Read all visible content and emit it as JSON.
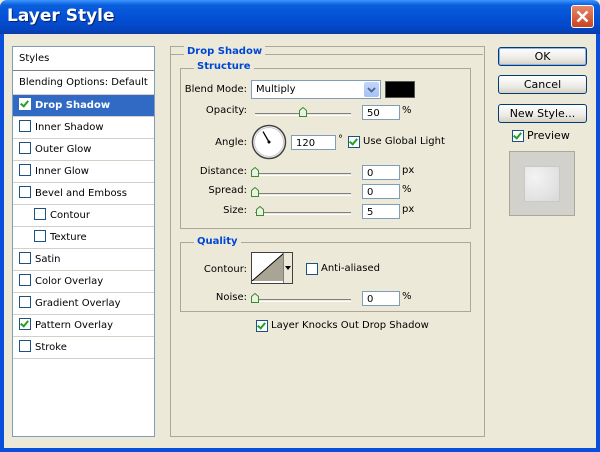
{
  "window": {
    "title": "Layer Style"
  },
  "styles_list": {
    "header": "Styles",
    "blending": "Blending Options: Default",
    "items": [
      {
        "label": "Drop Shadow",
        "checked": true,
        "selected": true,
        "indent": false
      },
      {
        "label": "Inner Shadow",
        "checked": false,
        "selected": false,
        "indent": false
      },
      {
        "label": "Outer Glow",
        "checked": false,
        "selected": false,
        "indent": false
      },
      {
        "label": "Inner Glow",
        "checked": false,
        "selected": false,
        "indent": false
      },
      {
        "label": "Bevel and Emboss",
        "checked": false,
        "selected": false,
        "indent": false
      },
      {
        "label": "Contour",
        "checked": false,
        "selected": false,
        "indent": true
      },
      {
        "label": "Texture",
        "checked": false,
        "selected": false,
        "indent": true
      },
      {
        "label": "Satin",
        "checked": false,
        "selected": false,
        "indent": false
      },
      {
        "label": "Color Overlay",
        "checked": false,
        "selected": false,
        "indent": false
      },
      {
        "label": "Gradient Overlay",
        "checked": false,
        "selected": false,
        "indent": false
      },
      {
        "label": "Pattern Overlay",
        "checked": true,
        "selected": false,
        "indent": false
      },
      {
        "label": "Stroke",
        "checked": false,
        "selected": false,
        "indent": false
      }
    ]
  },
  "drop_shadow": {
    "title": "Drop Shadow",
    "structure": {
      "title": "Structure",
      "blend_mode_label": "Blend Mode:",
      "blend_mode_value": "Multiply",
      "shadow_color": "#000000",
      "opacity_label": "Opacity:",
      "opacity_value": "50",
      "opacity_unit": "%",
      "opacity_level": 0.5,
      "angle_label": "Angle:",
      "angle_value": "120",
      "angle_degrees": 120,
      "degree_symbol": "°",
      "use_global_light_label": "Use Global Light",
      "use_global_light": true,
      "distance_label": "Distance:",
      "distance_value": "0",
      "distance_unit": "px",
      "spread_label": "Spread:",
      "spread_value": "0",
      "spread_unit": "%",
      "size_label": "Size:",
      "size_value": "5",
      "size_unit": "px"
    },
    "quality": {
      "title": "Quality",
      "contour_label": "Contour:",
      "anti_aliased_label": "Anti-aliased",
      "anti_aliased": false,
      "noise_label": "Noise:",
      "noise_value": "0",
      "noise_unit": "%"
    },
    "knockout_label": "Layer Knocks Out Drop Shadow",
    "knockout": true
  },
  "buttons": {
    "ok": "OK",
    "cancel": "Cancel",
    "new_style": "New Style...",
    "preview_label": "Preview",
    "preview_checked": true
  },
  "icons": {
    "close": "close-icon",
    "dropdown": "chevron-down-icon",
    "angle_dial": "angle-dial-icon",
    "contour": "contour-icon"
  }
}
